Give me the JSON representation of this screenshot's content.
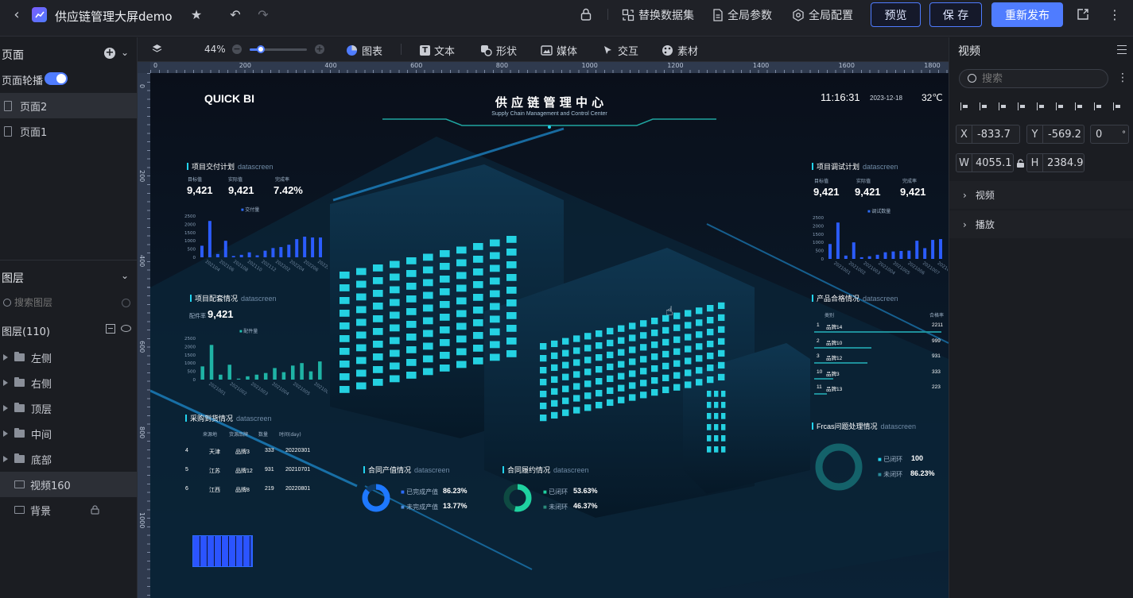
{
  "header": {
    "title": "供应链管理大屏demo",
    "actions": {
      "replace_dataset": "替换数据集",
      "global_params": "全局参数",
      "global_config": "全局配置",
      "preview": "预览",
      "save": "保 存",
      "republish": "重新发布"
    }
  },
  "toolbar": {
    "zoom": "44%",
    "zoom_fraction": 0.2,
    "items": [
      "图表",
      "文本",
      "形状",
      "媒体",
      "交互",
      "素材"
    ]
  },
  "ruler": {
    "h_ticks": [
      "0",
      "200",
      "400",
      "600",
      "800",
      "1000",
      "1200",
      "1400",
      "1600",
      "1800"
    ],
    "v_ticks": [
      "0",
      "200",
      "400",
      "600",
      "800",
      "1000"
    ]
  },
  "left": {
    "pages_title": "页面",
    "carousel_label": "页面轮播",
    "pages": [
      "页面2",
      "页面1"
    ],
    "layers_title": "图层",
    "search_placeholder": "搜索图层",
    "layers_count": "图层(110)",
    "layers": [
      "左侧",
      "右侧",
      "顶层",
      "中间",
      "底部",
      "视频160",
      "背景"
    ]
  },
  "right": {
    "title": "视频",
    "search_placeholder": "搜索",
    "x": "-833.7",
    "y": "-569.2",
    "angle": "0",
    "w": "4055.1",
    "h": "2384.9",
    "x_label": "X",
    "y_label": "Y",
    "w_label": "W",
    "h_label": "H",
    "degree": "°",
    "sections": [
      "视频",
      "播放"
    ]
  },
  "screen": {
    "brand": "QUICK BI",
    "title": "供 应 链 管 理 中 心",
    "subtitle": "Supply Chain Management and Control Center",
    "time": "11:16:31",
    "date": "2023-12-18",
    "temp": "32℃",
    "p1": {
      "title": "项目交付计划",
      "tag": "datascreen",
      "l1": "目标值",
      "l2": "实际值",
      "l3": "完成率",
      "v1": "9,421",
      "v2": "9,421",
      "v3": "7.42%",
      "legend": "交付量"
    },
    "p2": {
      "title": "项目配套情况",
      "tag": "datascreen",
      "label": "配件率",
      "value": "9,421",
      "legend": "配件量"
    },
    "p3": {
      "title": "采购到货情况",
      "tag": "datascreen",
      "headers": [
        "来源地",
        "货源品牌",
        "数量",
        "时间(day)"
      ],
      "rows": [
        [
          "4",
          "天津",
          "品牌3",
          "333",
          "20220301"
        ],
        [
          "5",
          "江苏",
          "品牌12",
          "931",
          "20210701"
        ],
        [
          "6",
          "江西",
          "品牌8",
          "219",
          "20220801"
        ]
      ]
    },
    "p4": {
      "title": "合同产值情况",
      "tag": "datascreen",
      "a": "已完成产值",
      "av": "86.23%",
      "b": "未完成产值",
      "bv": "13.77%"
    },
    "p5": {
      "title": "合同履约情况",
      "tag": "datascreen",
      "a": "已闭环",
      "av": "53.63%",
      "b": "未闭环",
      "bv": "46.37%"
    },
    "p6": {
      "title": "项目调试计划",
      "tag": "datascreen",
      "l1": "目标值",
      "l2": "实际值",
      "l3": "完成率",
      "v1": "9,421",
      "v2": "9,421",
      "v3": "9,421",
      "legend": "调试数量"
    },
    "p7": {
      "title": "产品合格情况",
      "tag": "datascreen",
      "c1": "类别",
      "c2": "合格率",
      "rows": [
        [
          "1",
          "品牌14",
          "2211"
        ],
        [
          "2",
          "品牌10",
          "999"
        ],
        [
          "3",
          "品牌12",
          "931"
        ],
        [
          "10",
          "品牌3",
          "333"
        ],
        [
          "11",
          "品牌13",
          "223"
        ]
      ]
    },
    "p8": {
      "title": "Frcas问题处理情况",
      "tag": "datascreen",
      "a": "已闭环",
      "av": "100",
      "b": "未闭环",
      "bv": "86.23%"
    }
  },
  "chart_data": [
    {
      "type": "bar",
      "title": "项目交付计划",
      "ylim": [
        0,
        2500
      ],
      "y_ticks": [
        "2500",
        "2000",
        "1500",
        "1000",
        "500",
        "0"
      ],
      "x_ticks": [
        "202104",
        "202106",
        "202108",
        "202110",
        "202112",
        "202202",
        "202204",
        "202206",
        "202208"
      ],
      "series": [
        {
          "name": "交付量",
          "values": [
            700,
            2200,
            200,
            1000,
            80,
            150,
            300,
            120,
            400,
            560,
            620,
            760,
            1100,
            1250,
            1200,
            1200
          ]
        }
      ]
    },
    {
      "type": "bar",
      "title": "项目配套情况",
      "ylim": [
        0,
        2500
      ],
      "y_ticks": [
        "2500",
        "2000",
        "1500",
        "1000",
        "500",
        "0"
      ],
      "x_ticks": [
        "2021001",
        "2021002",
        "2021003",
        "2021004",
        "2021005",
        "2021006"
      ],
      "series": [
        {
          "name": "配件量",
          "values": [
            800,
            2100,
            300,
            900,
            60,
            200,
            300,
            400,
            700,
            450,
            850,
            1000,
            500,
            1100
          ]
        }
      ]
    },
    {
      "type": "bar",
      "title": "项目调试计划",
      "ylim": [
        0,
        2500
      ],
      "y_ticks": [
        "2500",
        "2000",
        "1500",
        "1000",
        "500",
        "0"
      ],
      "x_ticks": [
        "2021001",
        "2021002",
        "2021003",
        "2021004",
        "2021005",
        "2021006",
        "2021007",
        "2021008"
      ],
      "series": [
        {
          "name": "调试数量",
          "values": [
            900,
            2200,
            200,
            1000,
            100,
            160,
            250,
            400,
            450,
            480,
            500,
            1100,
            650,
            1150,
            1200
          ]
        }
      ]
    }
  ]
}
